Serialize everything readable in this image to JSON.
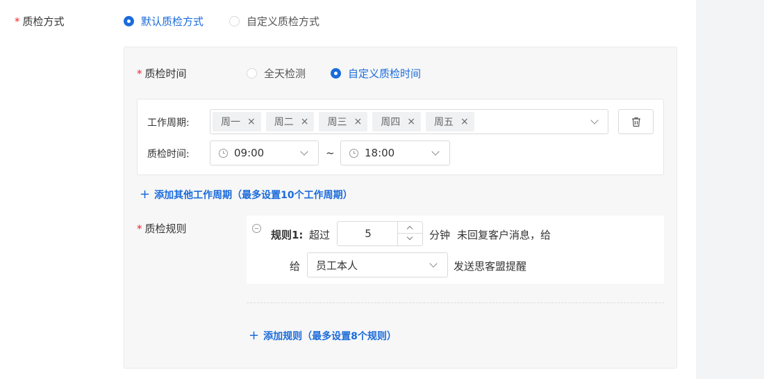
{
  "inspection_method": {
    "required_mark": "*",
    "label": "质检方式",
    "options": [
      {
        "label": "默认质检方式",
        "checked": true
      },
      {
        "label": "自定义质检方式",
        "checked": false
      }
    ]
  },
  "inspection_time": {
    "required_mark": "*",
    "label": "质检时间",
    "options": [
      {
        "label": "全天检测",
        "checked": false
      },
      {
        "label": "自定义质检时间",
        "checked": true
      }
    ]
  },
  "work_period": {
    "cycle_label": "工作周期:",
    "days": [
      "周一",
      "周二",
      "周三",
      "周四",
      "周五"
    ],
    "tag_remove_icon": "×",
    "time_label": "质检时间:",
    "start_time": "09:00",
    "separator": "~",
    "end_time": "18:00",
    "delete_icon": "trash-icon"
  },
  "add_period": {
    "plus": "+",
    "label": "添加其他工作周期（最多设置10个工作周期）"
  },
  "rules": {
    "required_mark": "*",
    "label": "质检规则",
    "items": [
      {
        "name": "规则1:",
        "exceed_text": "超过",
        "minutes": "5",
        "unit_text": "分钟",
        "condition_text": "未回复客户消息，给",
        "give_text": "给",
        "recipient": "员工本人",
        "action_text": "发送思客盟提醒"
      }
    ]
  },
  "add_rule": {
    "plus": "+",
    "label": "添加规则（最多设置8个规则）"
  },
  "colors": {
    "accent": "#1a6bdb",
    "required": "#f5222d",
    "panel_bg": "#f7f7f7"
  }
}
